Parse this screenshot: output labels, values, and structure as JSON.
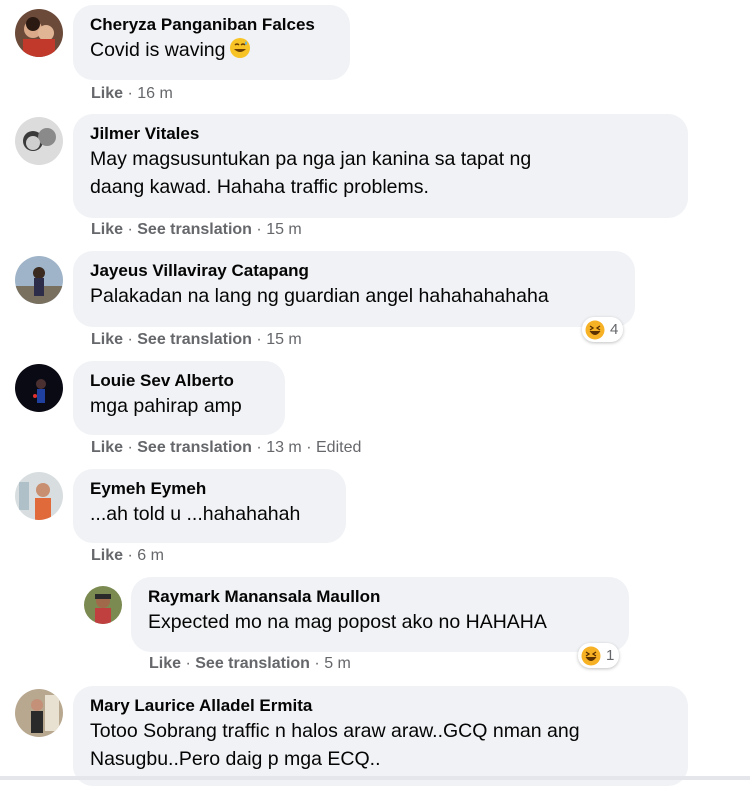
{
  "comments": [
    {
      "name": "Cheryza Panganiban Falces",
      "text": "Covid is waving",
      "emoji": "grinning-sweat-emoji",
      "like": "Like",
      "time": "16 m"
    },
    {
      "name": "Jilmer Vitales",
      "text_lines": [
        "May magsusuntukan pa nga jan kanina sa tapat ng",
        "daang kawad. Hahaha traffic problems."
      ],
      "like": "Like",
      "translate": "See translation",
      "time": "15 m"
    },
    {
      "name": "Jayeus Villaviray Catapang",
      "text": "Palakadan na lang ng guardian angel hahahahahaha",
      "like": "Like",
      "translate": "See translation",
      "time": "15 m",
      "reaction": {
        "icon": "haha-icon",
        "count": "4"
      }
    },
    {
      "name": "Louie Sev Alberto",
      "text": "mga pahirap amp",
      "like": "Like",
      "translate": "See translation",
      "time": "13 m",
      "edited": "Edited"
    },
    {
      "name": "Eymeh Eymeh",
      "text": "...ah told u ...hahahahah",
      "like": "Like",
      "time": "6 m"
    },
    {
      "name": "Raymark Manansala Maullon",
      "text": "Expected mo na mag popost ako no HAHAHA",
      "like": "Like",
      "translate": "See translation",
      "time": "5 m",
      "reaction": {
        "icon": "haha-icon",
        "count": "1"
      }
    },
    {
      "name": "Mary Laurice Alladel Ermita",
      "text_lines": [
        "Totoo Sobrang traffic n halos araw araw..GCQ nman ang",
        "Nasugbu..Pero daig p mga ECQ.."
      ]
    }
  ],
  "separator": "·",
  "colors": {
    "bubble": "#f0f2f5",
    "meta": "#65676b",
    "text": "#050505",
    "haha": "#f7b125"
  }
}
